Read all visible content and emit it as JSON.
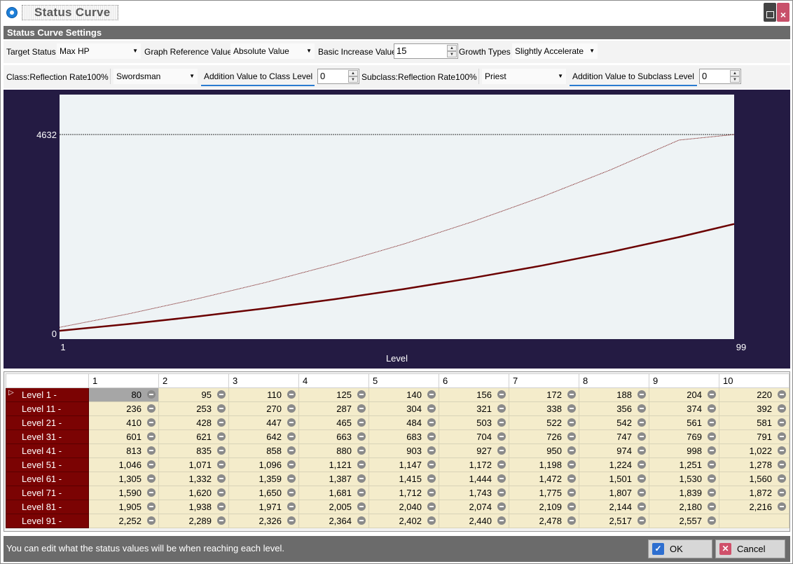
{
  "window": {
    "title": "Status Curve"
  },
  "section": {
    "title": "Status Curve Settings"
  },
  "settings": {
    "target_status_label": "Target Status",
    "target_status_value": "Max HP",
    "graph_ref_label": "Graph Reference Value",
    "graph_ref_value": "Absolute Value",
    "basic_increase_label": "Basic Increase Value",
    "basic_increase_value": "15",
    "growth_types_label": "Growth Types",
    "growth_types_value": "Slightly Accelerate",
    "class_reflection_label": "Class:Reflection Rate",
    "class_reflection_value": "100%",
    "class_value": "Swordsman",
    "class_addition_label": "Addition Value to Class Level",
    "class_addition_value": "0",
    "subclass_reflection_label": "Subclass:Reflection Rate",
    "subclass_reflection_value": "100%",
    "subclass_value": "Priest",
    "subclass_addition_label": "Addition Value to Subclass Level",
    "subclass_addition_value": "0"
  },
  "chart_data": {
    "type": "line",
    "xlabel": "Level",
    "x_range": [
      1,
      99
    ],
    "y_range": [
      0,
      4632
    ],
    "x_tick_labels": [
      "1",
      "99"
    ],
    "y_tick_labels": [
      "4632",
      "0"
    ],
    "reference_line": 4632,
    "series": [
      {
        "x": [
          1,
          11,
          21,
          31,
          41,
          51,
          61,
          71,
          81,
          91,
          99
        ],
        "y": [
          80,
          236,
          410,
          601,
          813,
          1046,
          1305,
          1590,
          1905,
          2252,
          2557
        ],
        "style": "thick"
      },
      {
        "x": [
          1,
          11,
          21,
          31,
          41,
          51,
          61,
          71,
          81,
          91,
          99
        ],
        "y": [
          160,
          472,
          820,
          1202,
          1626,
          2092,
          2610,
          3180,
          3810,
          4504,
          4632
        ],
        "style": "thin"
      }
    ]
  },
  "table": {
    "columns": [
      "1",
      "2",
      "3",
      "4",
      "5",
      "6",
      "7",
      "8",
      "9",
      "10"
    ],
    "rows": [
      {
        "label": "Level 1 -",
        "values": [
          "80",
          "95",
          "110",
          "125",
          "140",
          "156",
          "172",
          "188",
          "204",
          "220"
        ]
      },
      {
        "label": "Level 11 -",
        "values": [
          "236",
          "253",
          "270",
          "287",
          "304",
          "321",
          "338",
          "356",
          "374",
          "392"
        ]
      },
      {
        "label": "Level 21 -",
        "values": [
          "410",
          "428",
          "447",
          "465",
          "484",
          "503",
          "522",
          "542",
          "561",
          "581"
        ]
      },
      {
        "label": "Level 31 -",
        "values": [
          "601",
          "621",
          "642",
          "663",
          "683",
          "704",
          "726",
          "747",
          "769",
          "791"
        ]
      },
      {
        "label": "Level 41 -",
        "values": [
          "813",
          "835",
          "858",
          "880",
          "903",
          "927",
          "950",
          "974",
          "998",
          "1,022"
        ]
      },
      {
        "label": "Level 51 -",
        "values": [
          "1,046",
          "1,071",
          "1,096",
          "1,121",
          "1,147",
          "1,172",
          "1,198",
          "1,224",
          "1,251",
          "1,278"
        ]
      },
      {
        "label": "Level 61 -",
        "values": [
          "1,305",
          "1,332",
          "1,359",
          "1,387",
          "1,415",
          "1,444",
          "1,472",
          "1,501",
          "1,530",
          "1,560"
        ]
      },
      {
        "label": "Level 71 -",
        "values": [
          "1,590",
          "1,620",
          "1,650",
          "1,681",
          "1,712",
          "1,743",
          "1,775",
          "1,807",
          "1,839",
          "1,872"
        ]
      },
      {
        "label": "Level 81 -",
        "values": [
          "1,905",
          "1,938",
          "1,971",
          "2,005",
          "2,040",
          "2,074",
          "2,109",
          "2,144",
          "2,180",
          "2,216"
        ]
      },
      {
        "label": "Level 91 -",
        "values": [
          "2,252",
          "2,289",
          "2,326",
          "2,364",
          "2,402",
          "2,440",
          "2,478",
          "2,517",
          "2,557",
          ""
        ]
      }
    ]
  },
  "status": {
    "message": "You can edit what the status values will be when reaching each level."
  },
  "buttons": {
    "ok": "OK",
    "cancel": "Cancel"
  },
  "colors": {
    "row_header": "#7b0303",
    "cell_bg": "#f4eccb",
    "chart_bg": "#241b43",
    "plot_bg": "#eef3f5",
    "curve": "#6b0000"
  }
}
